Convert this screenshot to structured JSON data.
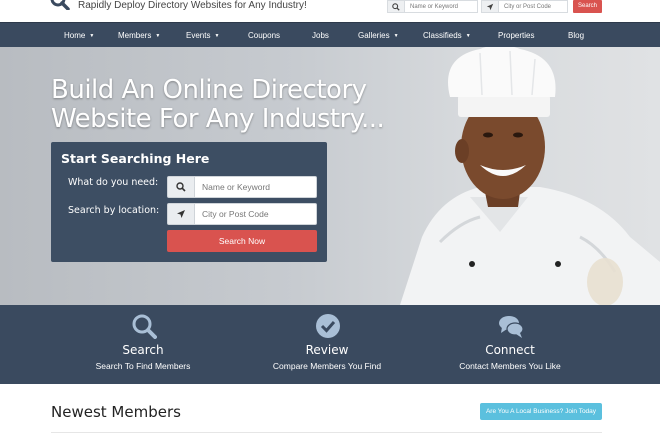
{
  "header": {
    "tagline": "Rapidly Deploy Directory Websites for Any Industry!",
    "search": {
      "keyword_placeholder": "Name or Keyword",
      "location_placeholder": "City or Post Code",
      "button_label": "Search"
    },
    "icons": [
      "magnifier-logo-icon",
      "search-icon",
      "location-arrow-icon"
    ]
  },
  "nav": {
    "items": [
      {
        "label": "Home",
        "dropdown": true
      },
      {
        "label": "Members",
        "dropdown": true
      },
      {
        "label": "Events",
        "dropdown": true
      },
      {
        "label": "Coupons",
        "dropdown": false
      },
      {
        "label": "Jobs",
        "dropdown": false
      },
      {
        "label": "Galleries",
        "dropdown": true
      },
      {
        "label": "Classifieds",
        "dropdown": true
      },
      {
        "label": "Properties",
        "dropdown": false
      },
      {
        "label": "Blog",
        "dropdown": false
      }
    ],
    "caret": "▼"
  },
  "hero": {
    "title_line1": "Build An Online Directory",
    "title_line2": "Website For Any Industry...",
    "search_box": {
      "title": "Start Searching Here",
      "need_label": "What do you need:",
      "location_label": "Search by location:",
      "keyword_placeholder": "Name or Keyword",
      "location_placeholder": "City or Post Code",
      "button_label": "Search Now"
    }
  },
  "features": [
    {
      "icon": "search-icon",
      "title": "Search",
      "subtitle": "Search To Find Members"
    },
    {
      "icon": "check-circle-icon",
      "title": "Review",
      "subtitle": "Compare Members You Find"
    },
    {
      "icon": "chat-bubbles-icon",
      "title": "Connect",
      "subtitle": "Contact Members You Like"
    }
  ],
  "newest": {
    "title": "Newest Members",
    "join_button": "Are You A Local Business? Join Today"
  },
  "colors": {
    "nav_bg": "#3a4a5f",
    "search_box_bg": "#3d4e63",
    "accent_red": "#d9534f",
    "accent_cyan": "#5bc0de",
    "icon_light_blue": "#a9bfd6"
  }
}
